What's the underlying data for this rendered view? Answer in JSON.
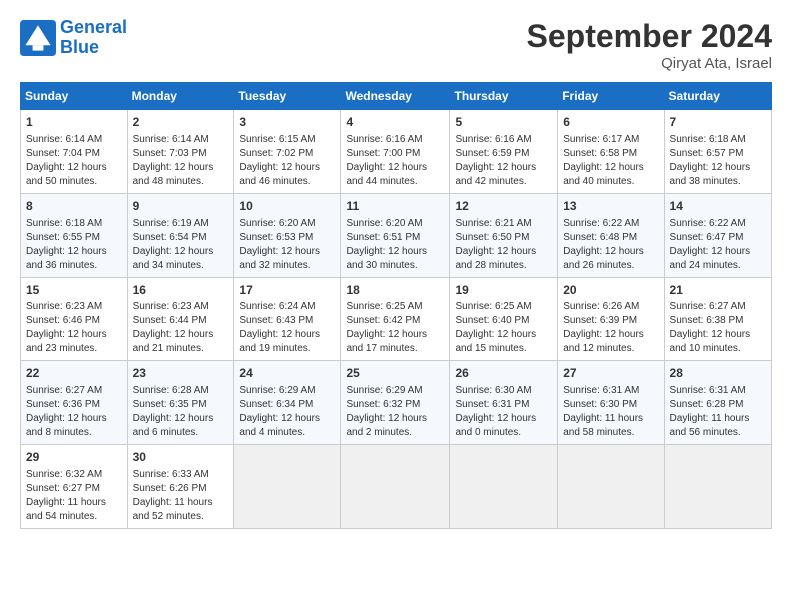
{
  "header": {
    "logo_line1": "General",
    "logo_line2": "Blue",
    "month": "September 2024",
    "location": "Qiryat Ata, Israel"
  },
  "days_of_week": [
    "Sunday",
    "Monday",
    "Tuesday",
    "Wednesday",
    "Thursday",
    "Friday",
    "Saturday"
  ],
  "weeks": [
    [
      {
        "day": "1",
        "lines": [
          "Sunrise: 6:14 AM",
          "Sunset: 7:04 PM",
          "Daylight: 12 hours",
          "and 50 minutes."
        ]
      },
      {
        "day": "2",
        "lines": [
          "Sunrise: 6:14 AM",
          "Sunset: 7:03 PM",
          "Daylight: 12 hours",
          "and 48 minutes."
        ]
      },
      {
        "day": "3",
        "lines": [
          "Sunrise: 6:15 AM",
          "Sunset: 7:02 PM",
          "Daylight: 12 hours",
          "and 46 minutes."
        ]
      },
      {
        "day": "4",
        "lines": [
          "Sunrise: 6:16 AM",
          "Sunset: 7:00 PM",
          "Daylight: 12 hours",
          "and 44 minutes."
        ]
      },
      {
        "day": "5",
        "lines": [
          "Sunrise: 6:16 AM",
          "Sunset: 6:59 PM",
          "Daylight: 12 hours",
          "and 42 minutes."
        ]
      },
      {
        "day": "6",
        "lines": [
          "Sunrise: 6:17 AM",
          "Sunset: 6:58 PM",
          "Daylight: 12 hours",
          "and 40 minutes."
        ]
      },
      {
        "day": "7",
        "lines": [
          "Sunrise: 6:18 AM",
          "Sunset: 6:57 PM",
          "Daylight: 12 hours",
          "and 38 minutes."
        ]
      }
    ],
    [
      {
        "day": "8",
        "lines": [
          "Sunrise: 6:18 AM",
          "Sunset: 6:55 PM",
          "Daylight: 12 hours",
          "and 36 minutes."
        ]
      },
      {
        "day": "9",
        "lines": [
          "Sunrise: 6:19 AM",
          "Sunset: 6:54 PM",
          "Daylight: 12 hours",
          "and 34 minutes."
        ]
      },
      {
        "day": "10",
        "lines": [
          "Sunrise: 6:20 AM",
          "Sunset: 6:53 PM",
          "Daylight: 12 hours",
          "and 32 minutes."
        ]
      },
      {
        "day": "11",
        "lines": [
          "Sunrise: 6:20 AM",
          "Sunset: 6:51 PM",
          "Daylight: 12 hours",
          "and 30 minutes."
        ]
      },
      {
        "day": "12",
        "lines": [
          "Sunrise: 6:21 AM",
          "Sunset: 6:50 PM",
          "Daylight: 12 hours",
          "and 28 minutes."
        ]
      },
      {
        "day": "13",
        "lines": [
          "Sunrise: 6:22 AM",
          "Sunset: 6:48 PM",
          "Daylight: 12 hours",
          "and 26 minutes."
        ]
      },
      {
        "day": "14",
        "lines": [
          "Sunrise: 6:22 AM",
          "Sunset: 6:47 PM",
          "Daylight: 12 hours",
          "and 24 minutes."
        ]
      }
    ],
    [
      {
        "day": "15",
        "lines": [
          "Sunrise: 6:23 AM",
          "Sunset: 6:46 PM",
          "Daylight: 12 hours",
          "and 23 minutes."
        ]
      },
      {
        "day": "16",
        "lines": [
          "Sunrise: 6:23 AM",
          "Sunset: 6:44 PM",
          "Daylight: 12 hours",
          "and 21 minutes."
        ]
      },
      {
        "day": "17",
        "lines": [
          "Sunrise: 6:24 AM",
          "Sunset: 6:43 PM",
          "Daylight: 12 hours",
          "and 19 minutes."
        ]
      },
      {
        "day": "18",
        "lines": [
          "Sunrise: 6:25 AM",
          "Sunset: 6:42 PM",
          "Daylight: 12 hours",
          "and 17 minutes."
        ]
      },
      {
        "day": "19",
        "lines": [
          "Sunrise: 6:25 AM",
          "Sunset: 6:40 PM",
          "Daylight: 12 hours",
          "and 15 minutes."
        ]
      },
      {
        "day": "20",
        "lines": [
          "Sunrise: 6:26 AM",
          "Sunset: 6:39 PM",
          "Daylight: 12 hours",
          "and 12 minutes."
        ]
      },
      {
        "day": "21",
        "lines": [
          "Sunrise: 6:27 AM",
          "Sunset: 6:38 PM",
          "Daylight: 12 hours",
          "and 10 minutes."
        ]
      }
    ],
    [
      {
        "day": "22",
        "lines": [
          "Sunrise: 6:27 AM",
          "Sunset: 6:36 PM",
          "Daylight: 12 hours",
          "and 8 minutes."
        ]
      },
      {
        "day": "23",
        "lines": [
          "Sunrise: 6:28 AM",
          "Sunset: 6:35 PM",
          "Daylight: 12 hours",
          "and 6 minutes."
        ]
      },
      {
        "day": "24",
        "lines": [
          "Sunrise: 6:29 AM",
          "Sunset: 6:34 PM",
          "Daylight: 12 hours",
          "and 4 minutes."
        ]
      },
      {
        "day": "25",
        "lines": [
          "Sunrise: 6:29 AM",
          "Sunset: 6:32 PM",
          "Daylight: 12 hours",
          "and 2 minutes."
        ]
      },
      {
        "day": "26",
        "lines": [
          "Sunrise: 6:30 AM",
          "Sunset: 6:31 PM",
          "Daylight: 12 hours",
          "and 0 minutes."
        ]
      },
      {
        "day": "27",
        "lines": [
          "Sunrise: 6:31 AM",
          "Sunset: 6:30 PM",
          "Daylight: 11 hours",
          "and 58 minutes."
        ]
      },
      {
        "day": "28",
        "lines": [
          "Sunrise: 6:31 AM",
          "Sunset: 6:28 PM",
          "Daylight: 11 hours",
          "and 56 minutes."
        ]
      }
    ],
    [
      {
        "day": "29",
        "lines": [
          "Sunrise: 6:32 AM",
          "Sunset: 6:27 PM",
          "Daylight: 11 hours",
          "and 54 minutes."
        ]
      },
      {
        "day": "30",
        "lines": [
          "Sunrise: 6:33 AM",
          "Sunset: 6:26 PM",
          "Daylight: 11 hours",
          "and 52 minutes."
        ]
      },
      null,
      null,
      null,
      null,
      null
    ]
  ]
}
